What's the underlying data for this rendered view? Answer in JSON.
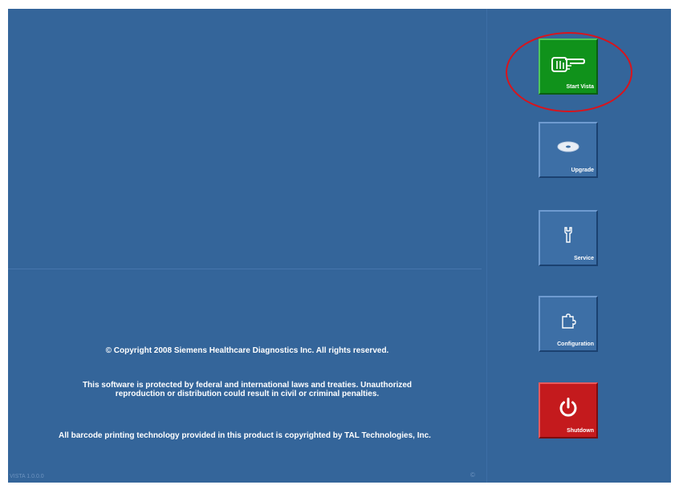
{
  "legal": {
    "copyright": "© Copyright 2008 Siemens Healthcare Diagnostics Inc. All rights reserved.",
    "protected_line1": "This software is protected by federal and international laws and treaties. Unauthorized",
    "protected_line2": "reproduction or distribution could result in civil or criminal penalties.",
    "barcode": "All barcode printing technology provided in this product is copyrighted by TAL Technologies, Inc."
  },
  "footer": {
    "version": "VISTA 1.0.0.0",
    "status_mark": "©"
  },
  "buttons": {
    "start_label": "Start Vista",
    "upgrade_label": "Upgrade",
    "service_label": "Service",
    "configuration_label": "Configuration",
    "shutdown_label": "Shutdown"
  },
  "icons": {
    "start": "pointing-hand-icon",
    "upgrade": "disc-icon",
    "service": "wrench-icon",
    "configuration": "puzzle-piece-icon",
    "shutdown": "power-icon"
  },
  "colors": {
    "background": "#34659a",
    "start_button": "#10921b",
    "shutdown_button": "#c41a1d",
    "highlight": "#d9141c"
  }
}
